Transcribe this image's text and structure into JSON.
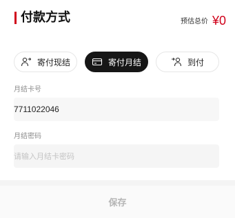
{
  "header": {
    "title": "付款方式",
    "estimate_label": "预估总价",
    "estimate_value": "¥0",
    "accent_color": "#d0021b"
  },
  "payment_methods": [
    {
      "label": "寄付现结",
      "icon": "person-arrow-icon",
      "active": false
    },
    {
      "label": "寄付月结",
      "icon": "card-icon",
      "active": true
    },
    {
      "label": "到付",
      "icon": "person-arrow-in-icon",
      "active": false
    }
  ],
  "fields": {
    "card_number_label": "月结卡号",
    "card_number_value": "7711022046",
    "password_label": "月结密码",
    "password_placeholder": "请输入月结卡密码"
  },
  "footer": {
    "save_label": "保存"
  }
}
